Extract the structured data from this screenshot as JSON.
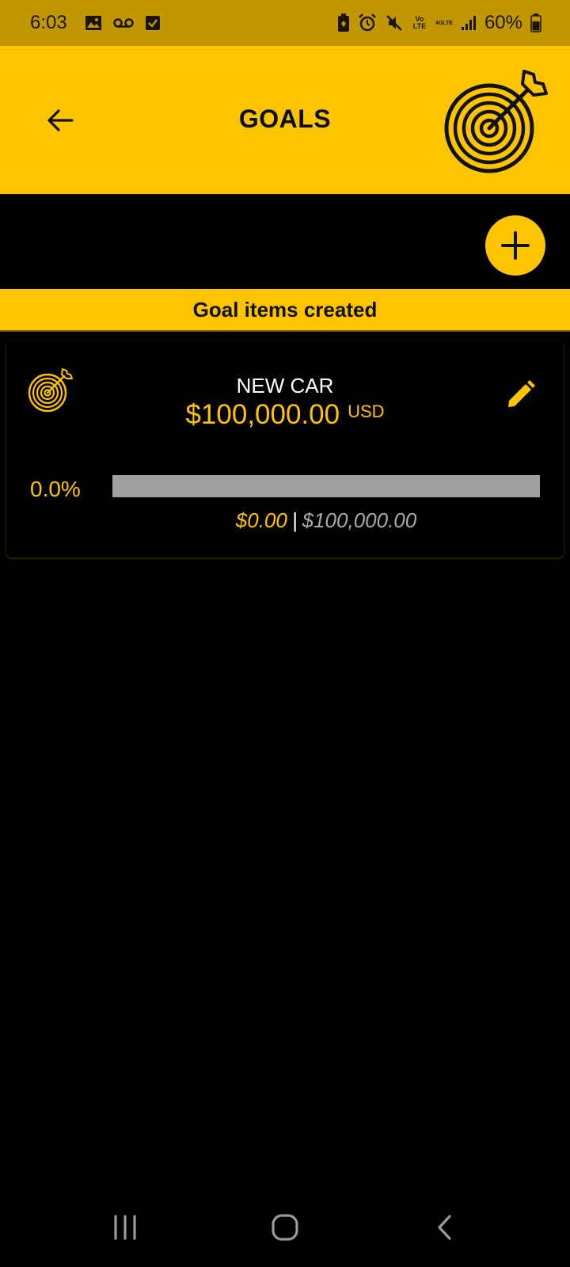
{
  "status_bar": {
    "time": "6:03",
    "battery": "60%",
    "left_icons": [
      "gallery-icon",
      "voicemail-icon",
      "checkbox-icon"
    ],
    "right_icons": [
      "battery-saver-icon",
      "alarm-icon",
      "mute-icon",
      "volte-icon",
      "4g-lte-icon",
      "signal-icon",
      "battery-icon"
    ],
    "volte_label": "Vo LTE",
    "lte_label": "4GLTE"
  },
  "app_bar": {
    "title": "GOALS",
    "back_icon": "arrow-left-icon",
    "header_icon": "target-arrow-icon"
  },
  "add_button": {
    "icon": "plus-icon"
  },
  "section": {
    "title": "Goal items created"
  },
  "goals": [
    {
      "name": "NEW CAR",
      "amount": "$100,000.00",
      "currency": "USD",
      "progress_percent_label": "0.0%",
      "progress_value": 0.0,
      "saved": "$0.00",
      "separator": "|",
      "target": "$100,000.00",
      "icon": "target-arrow-icon",
      "edit_icon": "pencil-icon"
    }
  ],
  "colors": {
    "accent": "#ffc400",
    "status_bar": "#c19700",
    "background": "#000000",
    "progress_track": "#a0a0a0",
    "muted_text": "#a8a8a8"
  },
  "nav_bar": {
    "recent_icon": "recent-apps-icon",
    "home_icon": "home-icon",
    "back_icon": "back-chevron-icon"
  }
}
